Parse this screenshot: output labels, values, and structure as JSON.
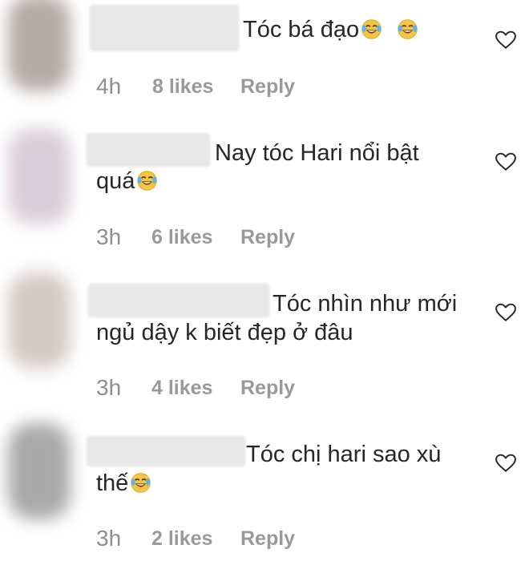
{
  "colors": {
    "text": "#262626",
    "meta": "#999999",
    "heart_stroke": "#262626",
    "emoji_face": "#f4c542"
  },
  "comments": [
    {
      "text": "Tóc bá đạo",
      "emoji_count": 2,
      "time": "4h",
      "likes": "8 likes",
      "reply": "Reply"
    },
    {
      "text_line1": "Nay tóc Hari nổi bật",
      "text_line2": "quá",
      "emoji_count": 1,
      "time": "3h",
      "likes": "6 likes",
      "reply": "Reply"
    },
    {
      "text_line1": "Tóc nhìn như mới",
      "text_line2": "ngủ dậy k biết đẹp ở đâu",
      "time": "3h",
      "likes": "4 likes",
      "reply": "Reply"
    },
    {
      "text_line1": "Tóc chị hari sao xù",
      "text_line2": "thế",
      "emoji_count": 1,
      "time": "3h",
      "likes": "2 likes",
      "reply": "Reply"
    }
  ],
  "icons": {
    "like": "heart-outline-icon",
    "emoji": "tears-of-joy-emoji-icon"
  }
}
